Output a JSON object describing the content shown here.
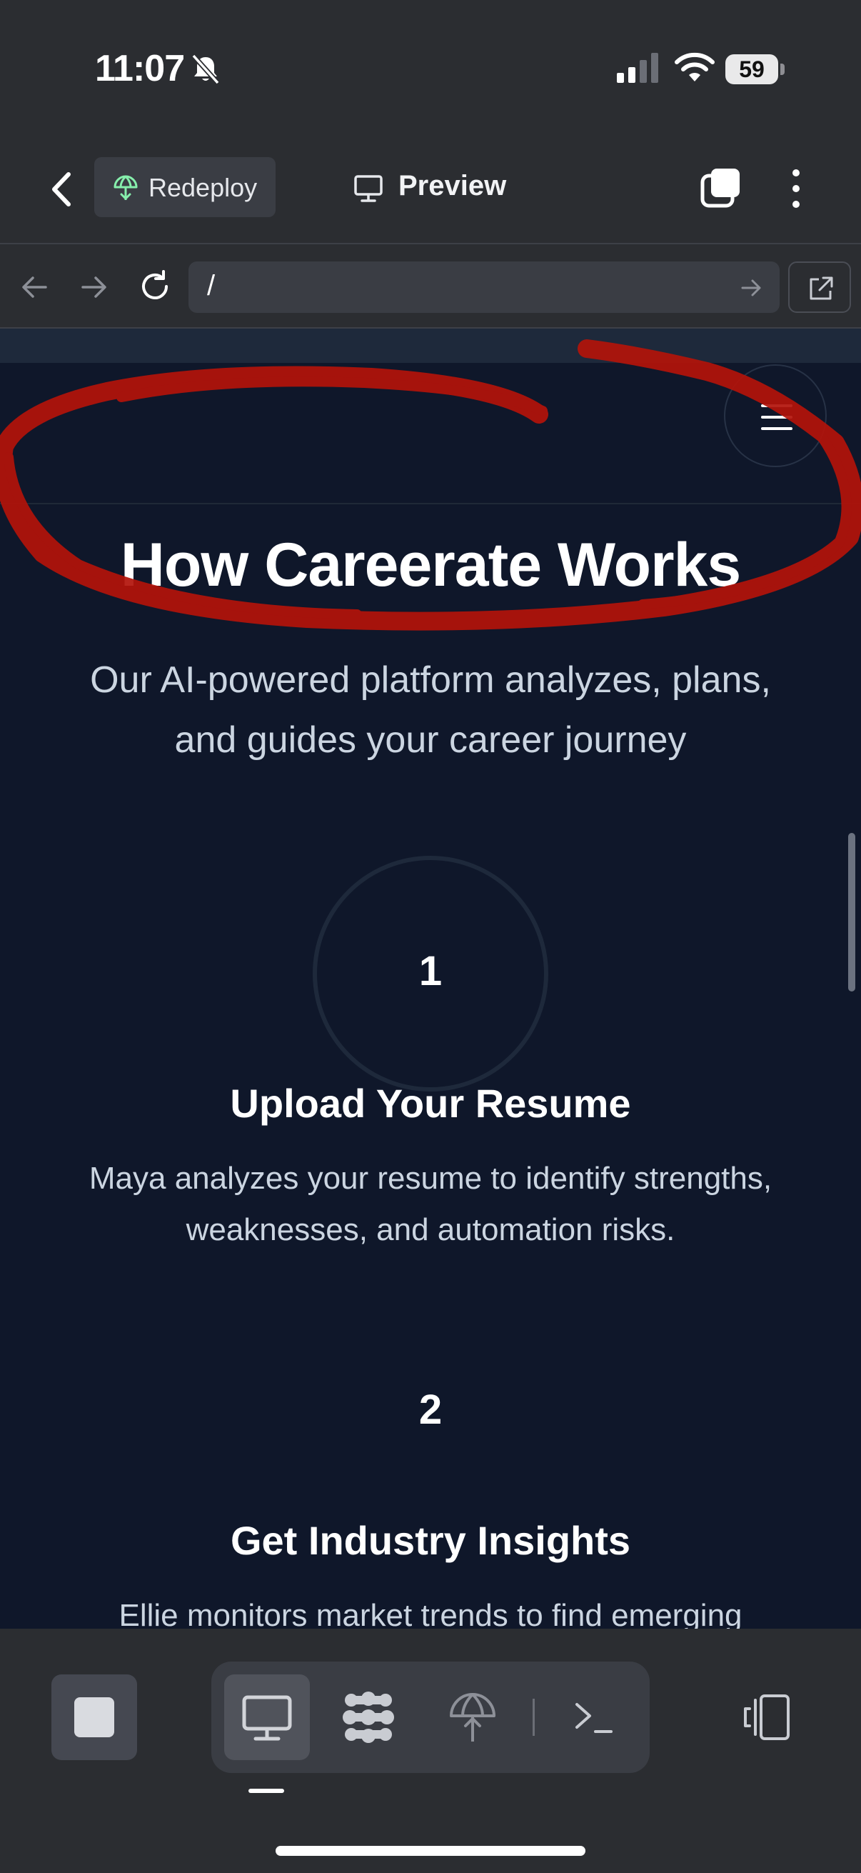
{
  "status_bar": {
    "time": "11:07",
    "battery": "59"
  },
  "app_bar": {
    "redeploy_label": "Redeploy",
    "preview_label": "Preview"
  },
  "url_bar": {
    "path": "/"
  },
  "section": {
    "title": "How Careerate Works",
    "subtitle_line1": "Our AI-powered platform analyzes, plans,",
    "subtitle_line2": "and guides your career journey"
  },
  "steps": [
    {
      "number": "1",
      "title": "Upload Your Resume",
      "desc_line1": "Maya analyzes your resume to identify strengths,",
      "desc_line2": "weaknesses, and automation risks."
    },
    {
      "number": "2",
      "title": "Get Industry Insights",
      "desc_line1": "Ellie monitors market trends to find emerging"
    }
  ],
  "colors": {
    "page_bg": "#0f172a",
    "chrome_bg": "#2b2d31",
    "annotation": "#b3130a",
    "redeploy_icon": "#86efac"
  },
  "icons": [
    "silent-bell-icon",
    "cellular-signal-icon",
    "wifi-icon",
    "battery-icon",
    "chevron-left-icon",
    "deploy-icon",
    "monitor-icon",
    "tabs-icon",
    "more-vertical-icon",
    "arrow-left-icon",
    "arrow-right-icon",
    "reload-icon",
    "open-external-icon",
    "hamburger-menu-icon",
    "stop-icon",
    "agent-icon",
    "terminal-icon",
    "layout-icon"
  ]
}
